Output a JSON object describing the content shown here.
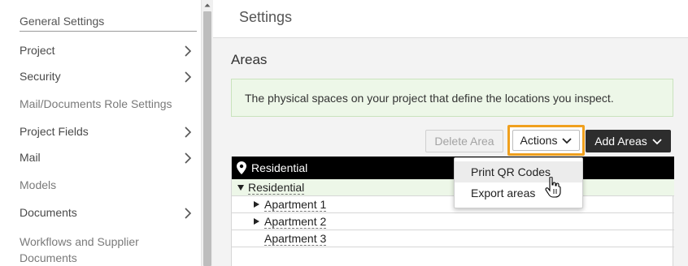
{
  "sidebar": {
    "header": "General Settings",
    "items": [
      {
        "label": "Project",
        "has_chevron": true
      },
      {
        "label": "Security",
        "has_chevron": true
      },
      {
        "label": "Mail/Documents Role Settings",
        "has_chevron": false
      },
      {
        "label": "Project Fields",
        "has_chevron": true
      },
      {
        "label": "Mail",
        "has_chevron": true
      },
      {
        "label": "Models",
        "has_chevron": false
      },
      {
        "label": "Documents",
        "has_chevron": true
      },
      {
        "label": "Workflows and Supplier",
        "has_chevron": false
      },
      {
        "label": "Documents",
        "has_chevron": false
      }
    ]
  },
  "header": {
    "title": "Settings"
  },
  "main": {
    "section_title": "Areas",
    "info_text": "The physical spaces on your project that define the locations you inspect.",
    "buttons": {
      "delete": "Delete Area",
      "actions": "Actions",
      "add": "Add Areas"
    },
    "table": {
      "header": "Residential",
      "rows": [
        {
          "label": "Residential",
          "indent": 0,
          "expander": "expanded"
        },
        {
          "label": "Apartment 1",
          "indent": 1,
          "expander": "collapsed"
        },
        {
          "label": "Apartment 2",
          "indent": 1,
          "expander": "collapsed"
        },
        {
          "label": "Apartment 3",
          "indent": 1,
          "expander": "none"
        }
      ]
    },
    "actions_menu": {
      "items": [
        "Print QR Codes",
        "Export areas"
      ],
      "hovered_index": 0
    }
  },
  "colors": {
    "accent_highlight": "#f0a01e",
    "info_background": "#edf7e8",
    "table_header": "#000000",
    "primary_button": "#2d2d2d"
  },
  "icons": {
    "chevron": "chevron-right-icon",
    "pin": "location-pin-icon",
    "caret": "chevron-down-icon",
    "cursor": "hand-pointer-icon"
  }
}
